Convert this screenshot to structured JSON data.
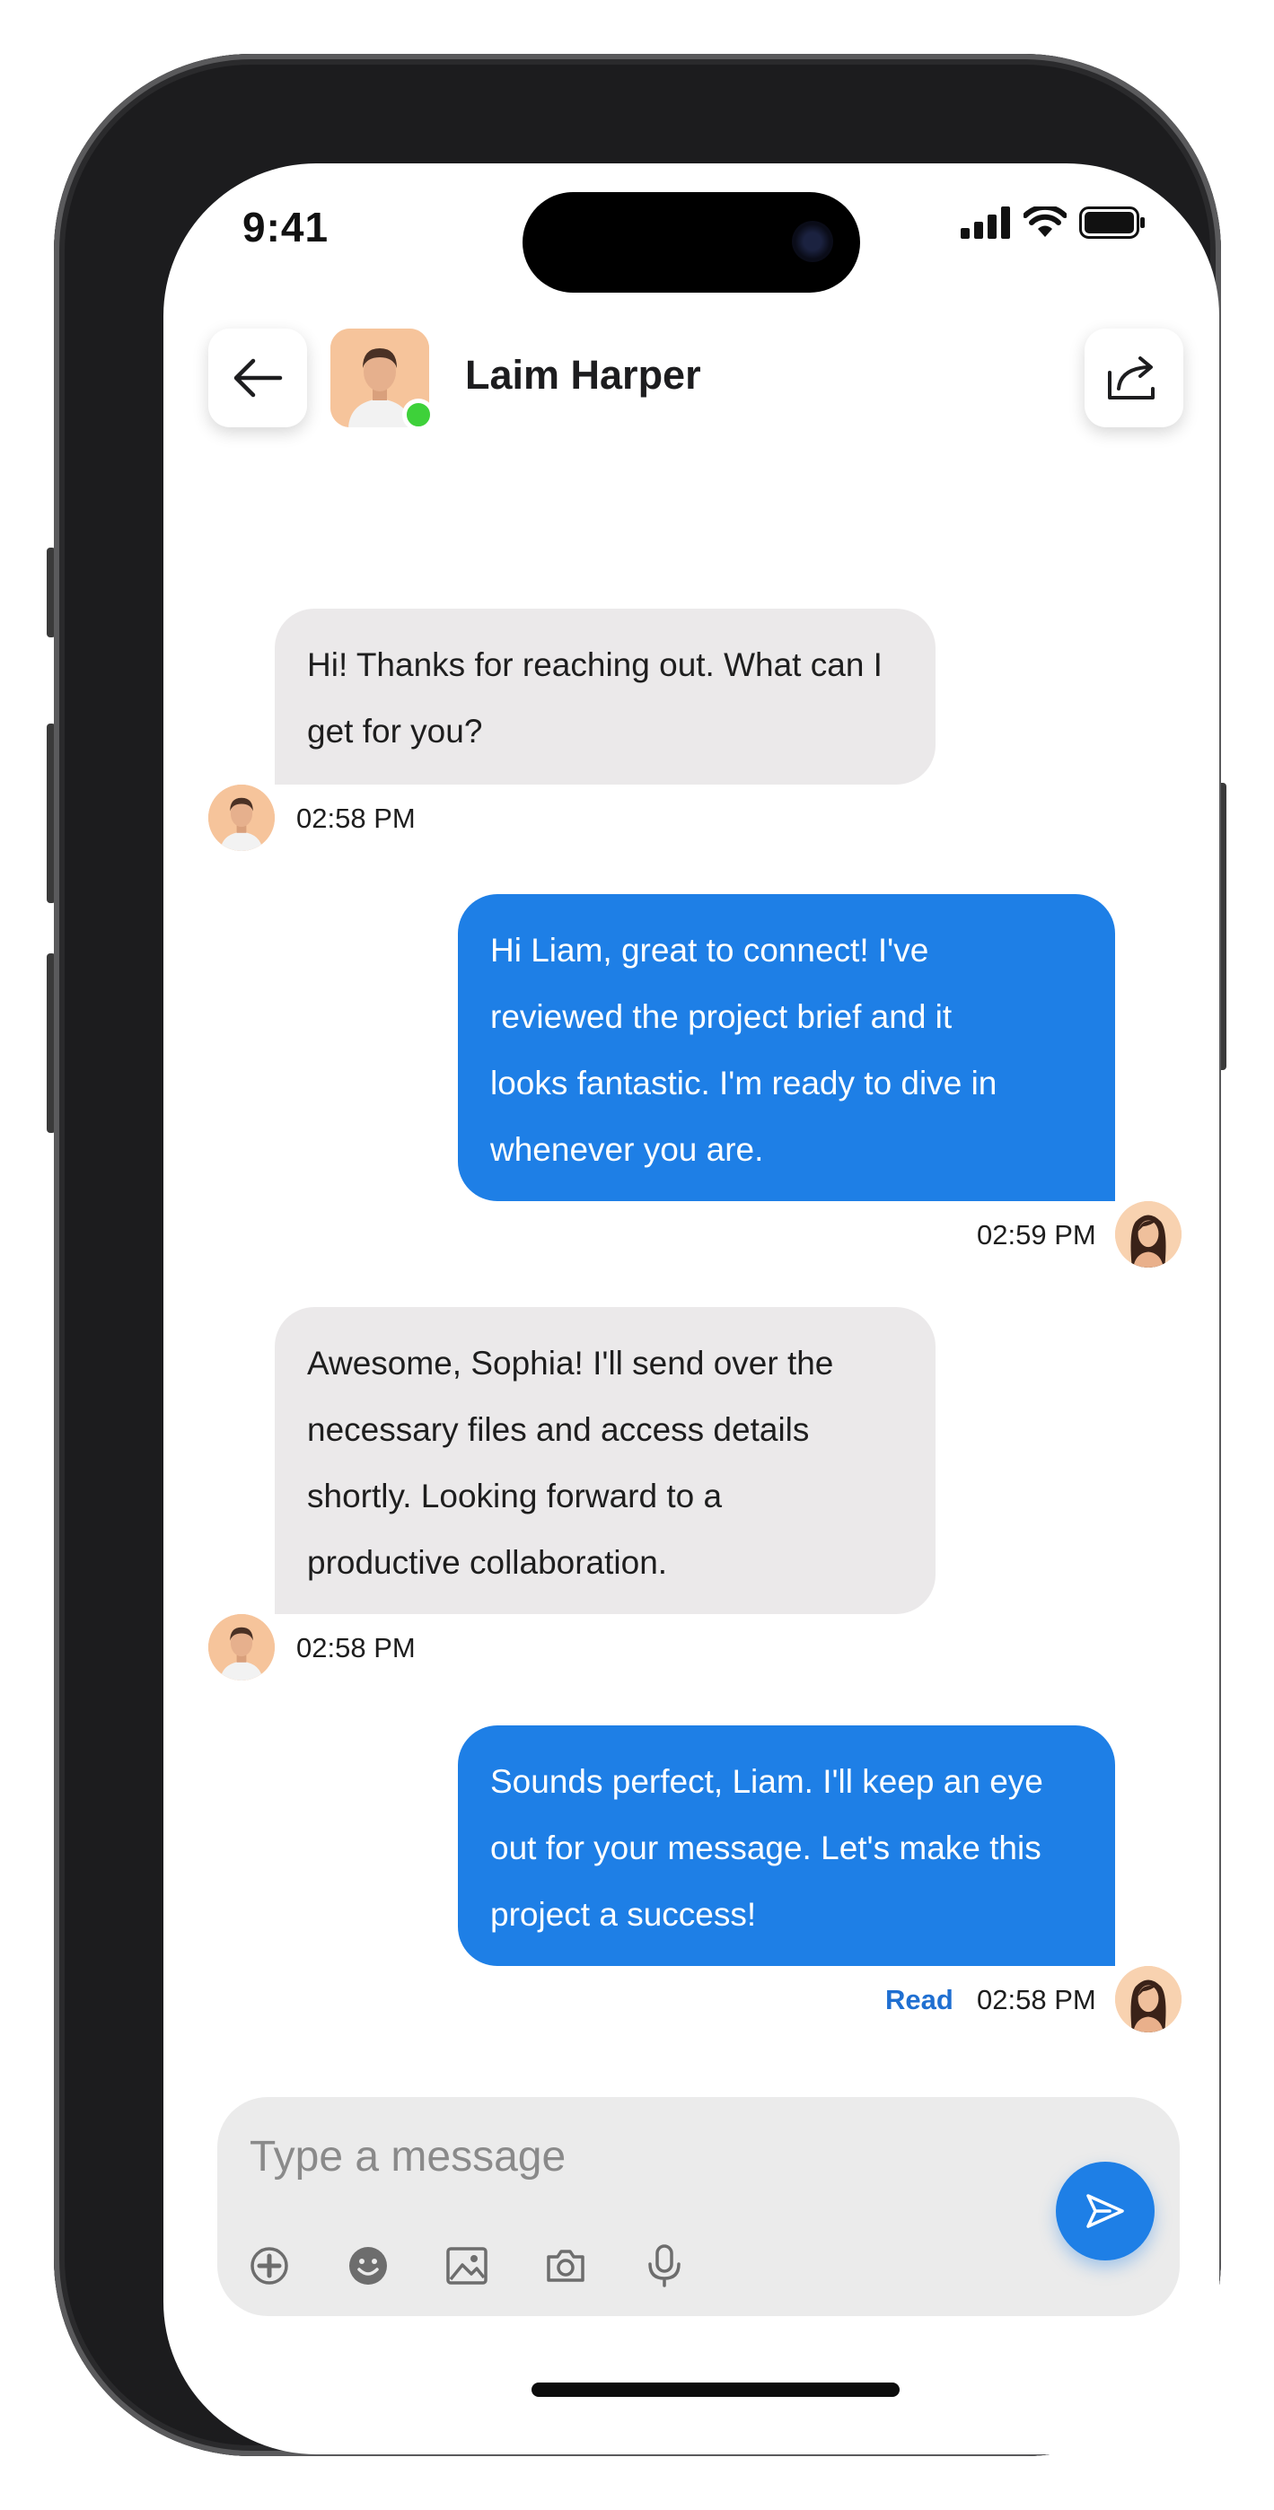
{
  "status_bar": {
    "time": "9:41",
    "icons": [
      "cellular-signal-icon",
      "wifi-icon",
      "battery-icon"
    ]
  },
  "header": {
    "back_icon": "arrow-left-icon",
    "contact_name": "Laim Harper",
    "online": true,
    "share_icon": "share-icon"
  },
  "messages": [
    {
      "direction": "incoming",
      "text": "Hi! Thanks for reaching out. What can I\nget for you?",
      "time": "02:58 PM"
    },
    {
      "direction": "outgoing",
      "text": "Hi Liam, great to connect! I've\nreviewed the project brief and it\nlooks fantastic. I'm ready to dive in\nwhenever you are.",
      "time": "02:59 PM"
    },
    {
      "direction": "incoming",
      "text": "Awesome, Sophia! I'll send over the\nnecessary files and access details\nshortly. Looking forward to a\nproductive collaboration.",
      "time": "02:58 PM"
    },
    {
      "direction": "outgoing",
      "text": "Sounds perfect, Liam. I'll keep an eye\nout for your message. Let's make this\nproject a success!",
      "time": "02:58 PM",
      "status": "Read"
    }
  ],
  "composer": {
    "placeholder": "Type a message",
    "tools": [
      "add-icon",
      "emoji-icon",
      "image-icon",
      "camera-icon",
      "microphone-icon"
    ],
    "send_icon": "send-icon"
  },
  "colors": {
    "accent": "#1e7fe6",
    "incoming_bubble": "#ebe9ea",
    "read_label": "#1f6fd1",
    "online": "#3ed13a",
    "avatar_bg": "#f6c49b"
  }
}
